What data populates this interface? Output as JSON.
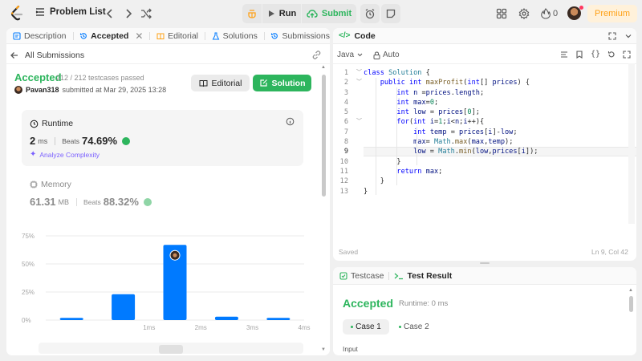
{
  "topnav": {
    "problem_list": "Problem List",
    "run": "Run",
    "submit": "Submit",
    "fire_count": "0",
    "premium": "Premium"
  },
  "left": {
    "tabs": [
      {
        "label": "Description"
      },
      {
        "label": "Accepted"
      },
      {
        "label": "Editorial"
      },
      {
        "label": "Solutions"
      },
      {
        "label": "Submissions"
      }
    ],
    "all_submissions": "All Submissions",
    "status": "Accepted",
    "testcases": "212 / 212 testcases passed",
    "username": "Pavan318",
    "submitted_at": "submitted at Mar 29, 2025 13:28",
    "editorial_btn": "Editorial",
    "solution_btn": "Solution",
    "runtime": {
      "title": "Runtime",
      "value": "2",
      "unit": "ms",
      "beats_label": "Beats",
      "beats_value": "74.69%",
      "analyze": "Analyze Complexity"
    },
    "memory": {
      "title": "Memory",
      "value": "61.31",
      "unit": "MB",
      "beats_label": "Beats",
      "beats_value": "88.32%"
    }
  },
  "chart_data": {
    "type": "bar",
    "categories": [
      "",
      "1ms",
      "2ms",
      "3ms",
      "4ms"
    ],
    "values": [
      2,
      23,
      67,
      3,
      2
    ],
    "highlight_index": 2,
    "yticks": [
      "0%",
      "25%",
      "50%",
      "75%"
    ],
    "ylim": [
      0,
      75
    ],
    "bar_color": "#007aff",
    "grid": true
  },
  "code": {
    "title": "Code",
    "language": "Java",
    "auto": "Auto",
    "saved": "Saved",
    "cursor": "Ln 9, Col 42"
  },
  "result": {
    "testcase_tab": "Testcase",
    "result_tab": "Test Result",
    "status": "Accepted",
    "runtime": "Runtime: 0 ms",
    "case1": "Case 1",
    "case2": "Case 2",
    "input_label": "Input"
  }
}
